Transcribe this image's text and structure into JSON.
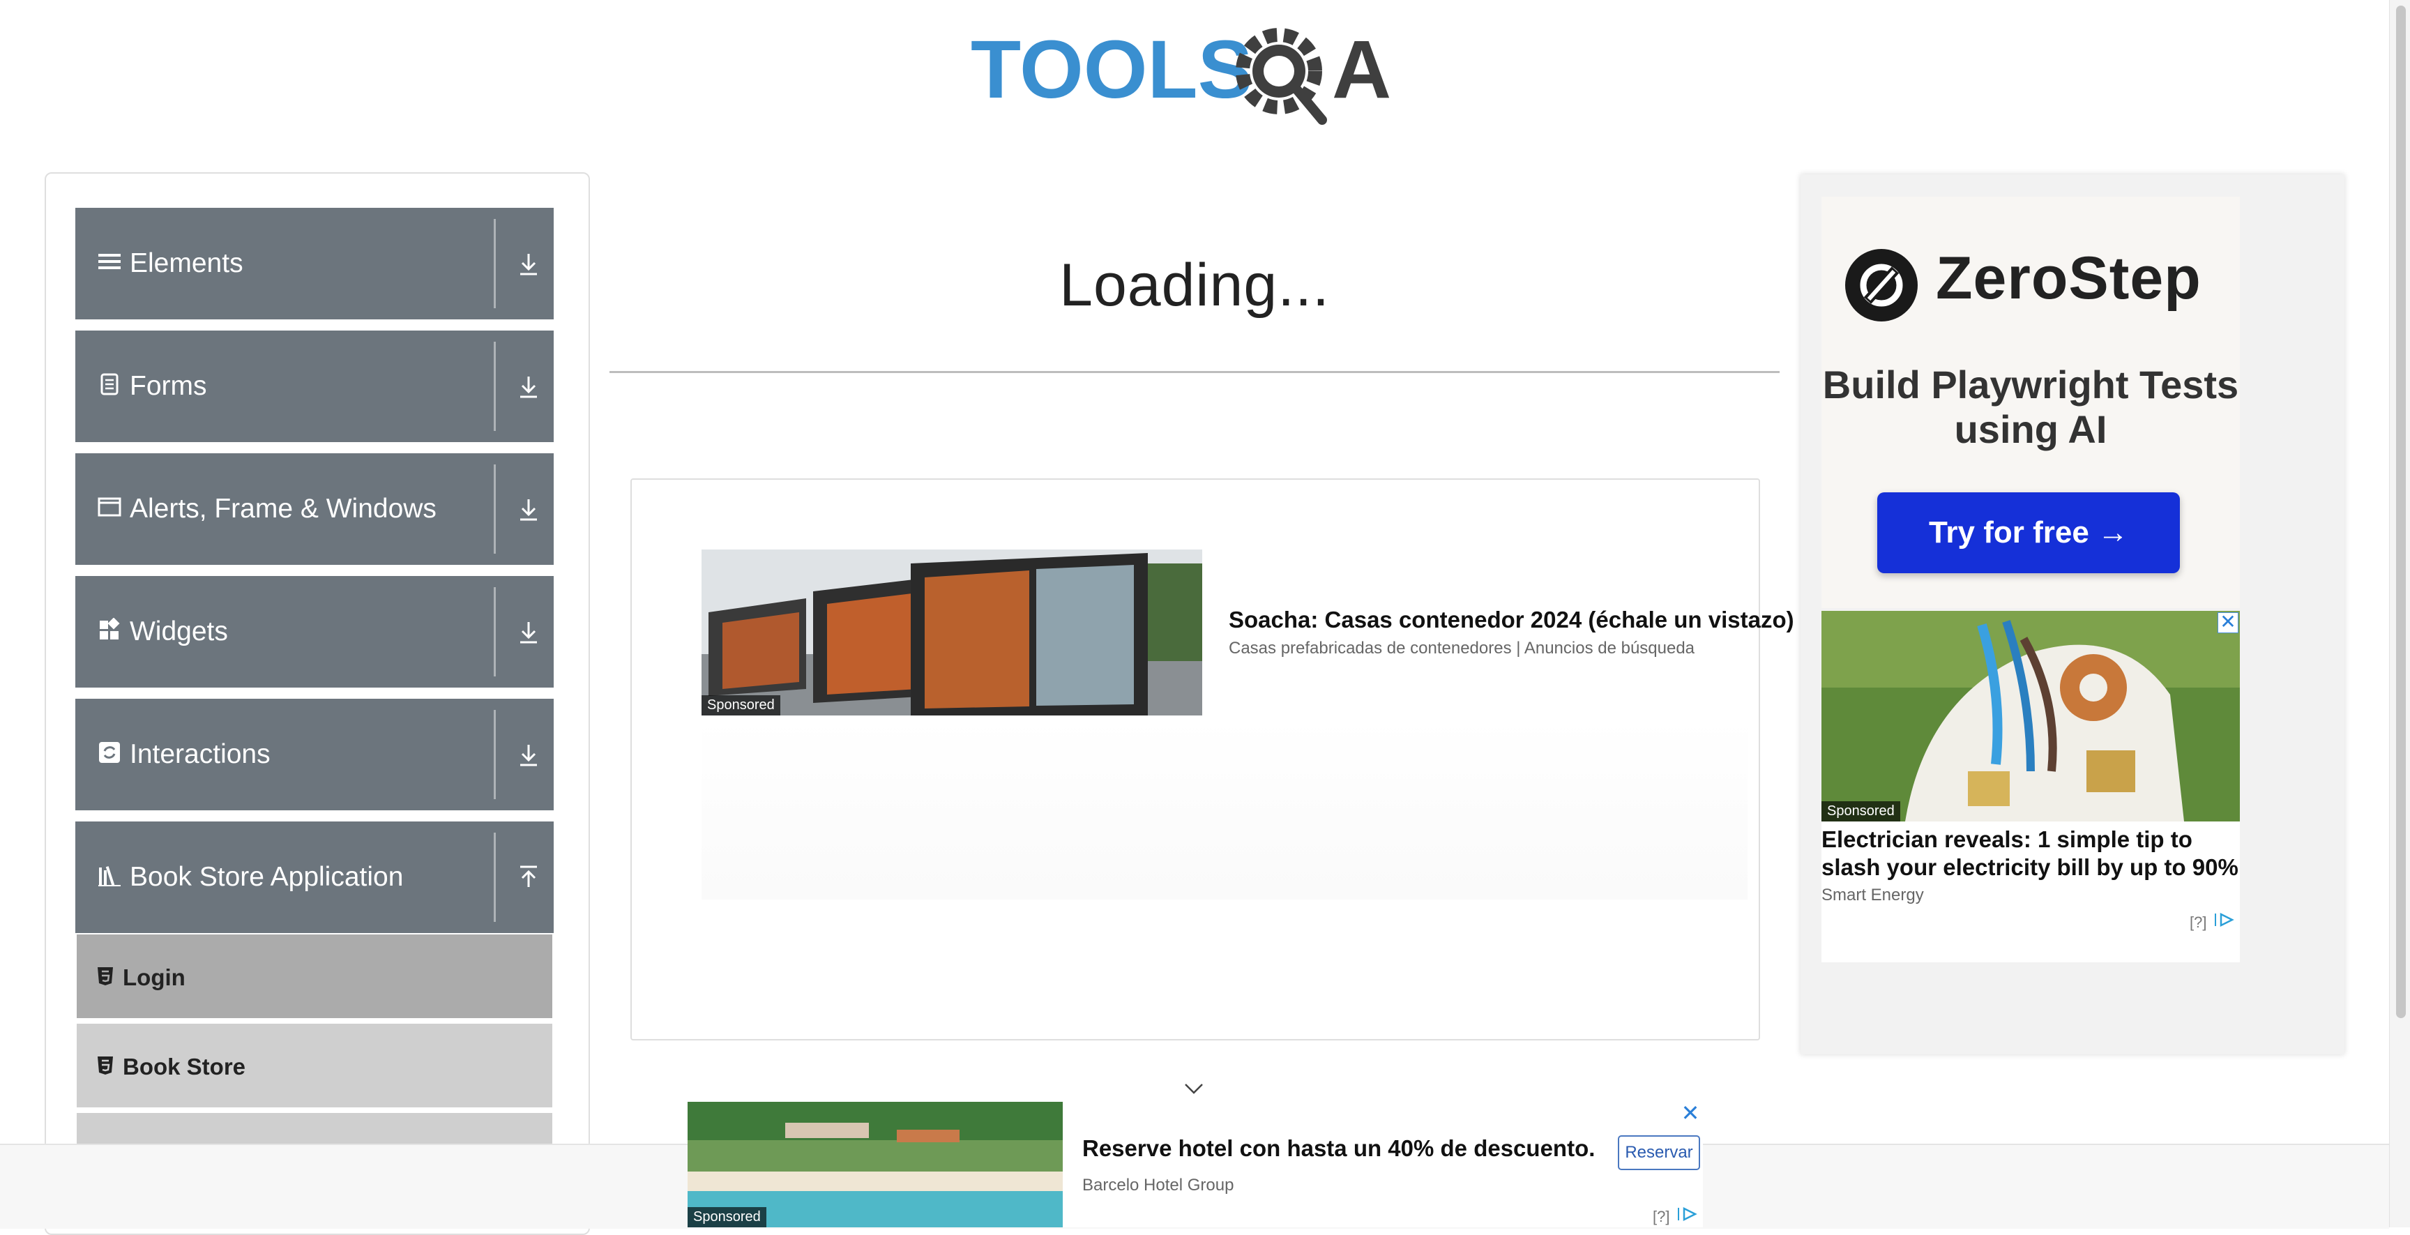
{
  "logo": {
    "text_left": "TOOLS",
    "text_right": "A"
  },
  "sidebar": {
    "groups": [
      {
        "label": "Elements",
        "icon": "hamburger-icon"
      },
      {
        "label": "Forms",
        "icon": "document-icon"
      },
      {
        "label": "Alerts, Frame & Windows",
        "icon": "window-icon"
      },
      {
        "label": "Widgets",
        "icon": "widgets-icon"
      },
      {
        "label": "Interactions",
        "icon": "interactions-icon"
      },
      {
        "label": "Book Store Application",
        "icon": "library-icon"
      }
    ],
    "book_store_items": [
      {
        "label": "Login",
        "active": true
      },
      {
        "label": "Book Store",
        "active": false
      }
    ]
  },
  "main": {
    "loading_text": "Loading...",
    "ad": {
      "title": "Soacha: Casas contenedor 2024 (échale un vistazo)",
      "subtitle": "Casas prefabricadas de contenedores | Anuncios de búsqueda",
      "sponsored": "Sponsored"
    }
  },
  "right_ad": {
    "brand": "ZeroStep",
    "tagline": "Build Playwright Tests using AI",
    "cta": "Try for free →",
    "second_ad": {
      "sponsored": "Sponsored",
      "title": "Electrician reveals: 1 simple tip to slash your electricity bill by up to 90%",
      "source": "Smart Energy",
      "info": "[?]",
      "close": "✕"
    }
  },
  "bottom_ad": {
    "sponsored": "Sponsored",
    "title": "Reserve hotel con hasta un 40% de descuento.",
    "source": "Barcelo Hotel Group",
    "button": "Reservar",
    "info": "[?]",
    "close": "✕"
  },
  "colors": {
    "logo_blue": "#3a8fd0",
    "logo_gray": "#3f3f3f",
    "sidebar_header": "#6c757d",
    "sidebar_item": "#cfcfcf",
    "sidebar_item_active": "#ababab",
    "cta_blue": "#1530d8"
  }
}
